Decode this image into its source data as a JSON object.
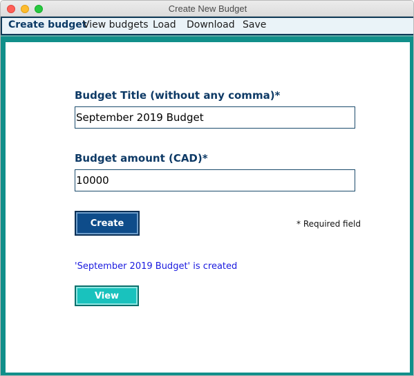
{
  "window": {
    "title": "Create New Budget"
  },
  "menu": {
    "items": [
      {
        "label": "Create budget",
        "active": true
      },
      {
        "label": "View budgets",
        "active": false
      },
      {
        "label": "Load",
        "active": false
      },
      {
        "label": "Download",
        "active": false
      },
      {
        "label": "Save",
        "active": false
      }
    ]
  },
  "form": {
    "title_label": "Budget Title (without any comma)*",
    "title_value": "September 2019 Budget",
    "amount_label": "Budget amount (CAD)*",
    "amount_value": "10000",
    "create_label": "Create",
    "required_note": "* Required field",
    "status_message": "'September 2019 Budget' is created",
    "view_label": "View"
  },
  "colors": {
    "menu_border": "#0f3a57",
    "frame": "#118f8a",
    "label": "#0e3a66",
    "create_button": "#0e4c8a",
    "view_button": "#19c2bd",
    "status_message": "#1a1adf"
  }
}
